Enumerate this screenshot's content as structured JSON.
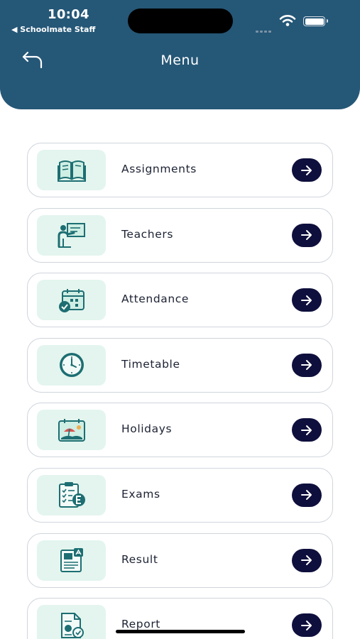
{
  "status_bar": {
    "time": "10:04",
    "back_app": "◀ Schoolmate Staff"
  },
  "header": {
    "title": "Menu"
  },
  "colors": {
    "header_bg": "#255777",
    "icon_tile_bg": "#e3f5ee",
    "arrow_button_bg": "#0f0f3d",
    "icon_accent": "#1d6e72"
  },
  "menu": {
    "items": [
      {
        "label": "Assignments",
        "icon": "book-icon"
      },
      {
        "label": "Teachers",
        "icon": "teacher-board-icon"
      },
      {
        "label": "Attendance",
        "icon": "calendar-check-icon"
      },
      {
        "label": "Timetable",
        "icon": "clock-icon"
      },
      {
        "label": "Holidays",
        "icon": "beach-calendar-icon"
      },
      {
        "label": "Exams",
        "icon": "exam-clipboard-icon"
      },
      {
        "label": "Result",
        "icon": "result-document-icon"
      },
      {
        "label": "Report",
        "icon": "report-document-icon"
      }
    ]
  }
}
